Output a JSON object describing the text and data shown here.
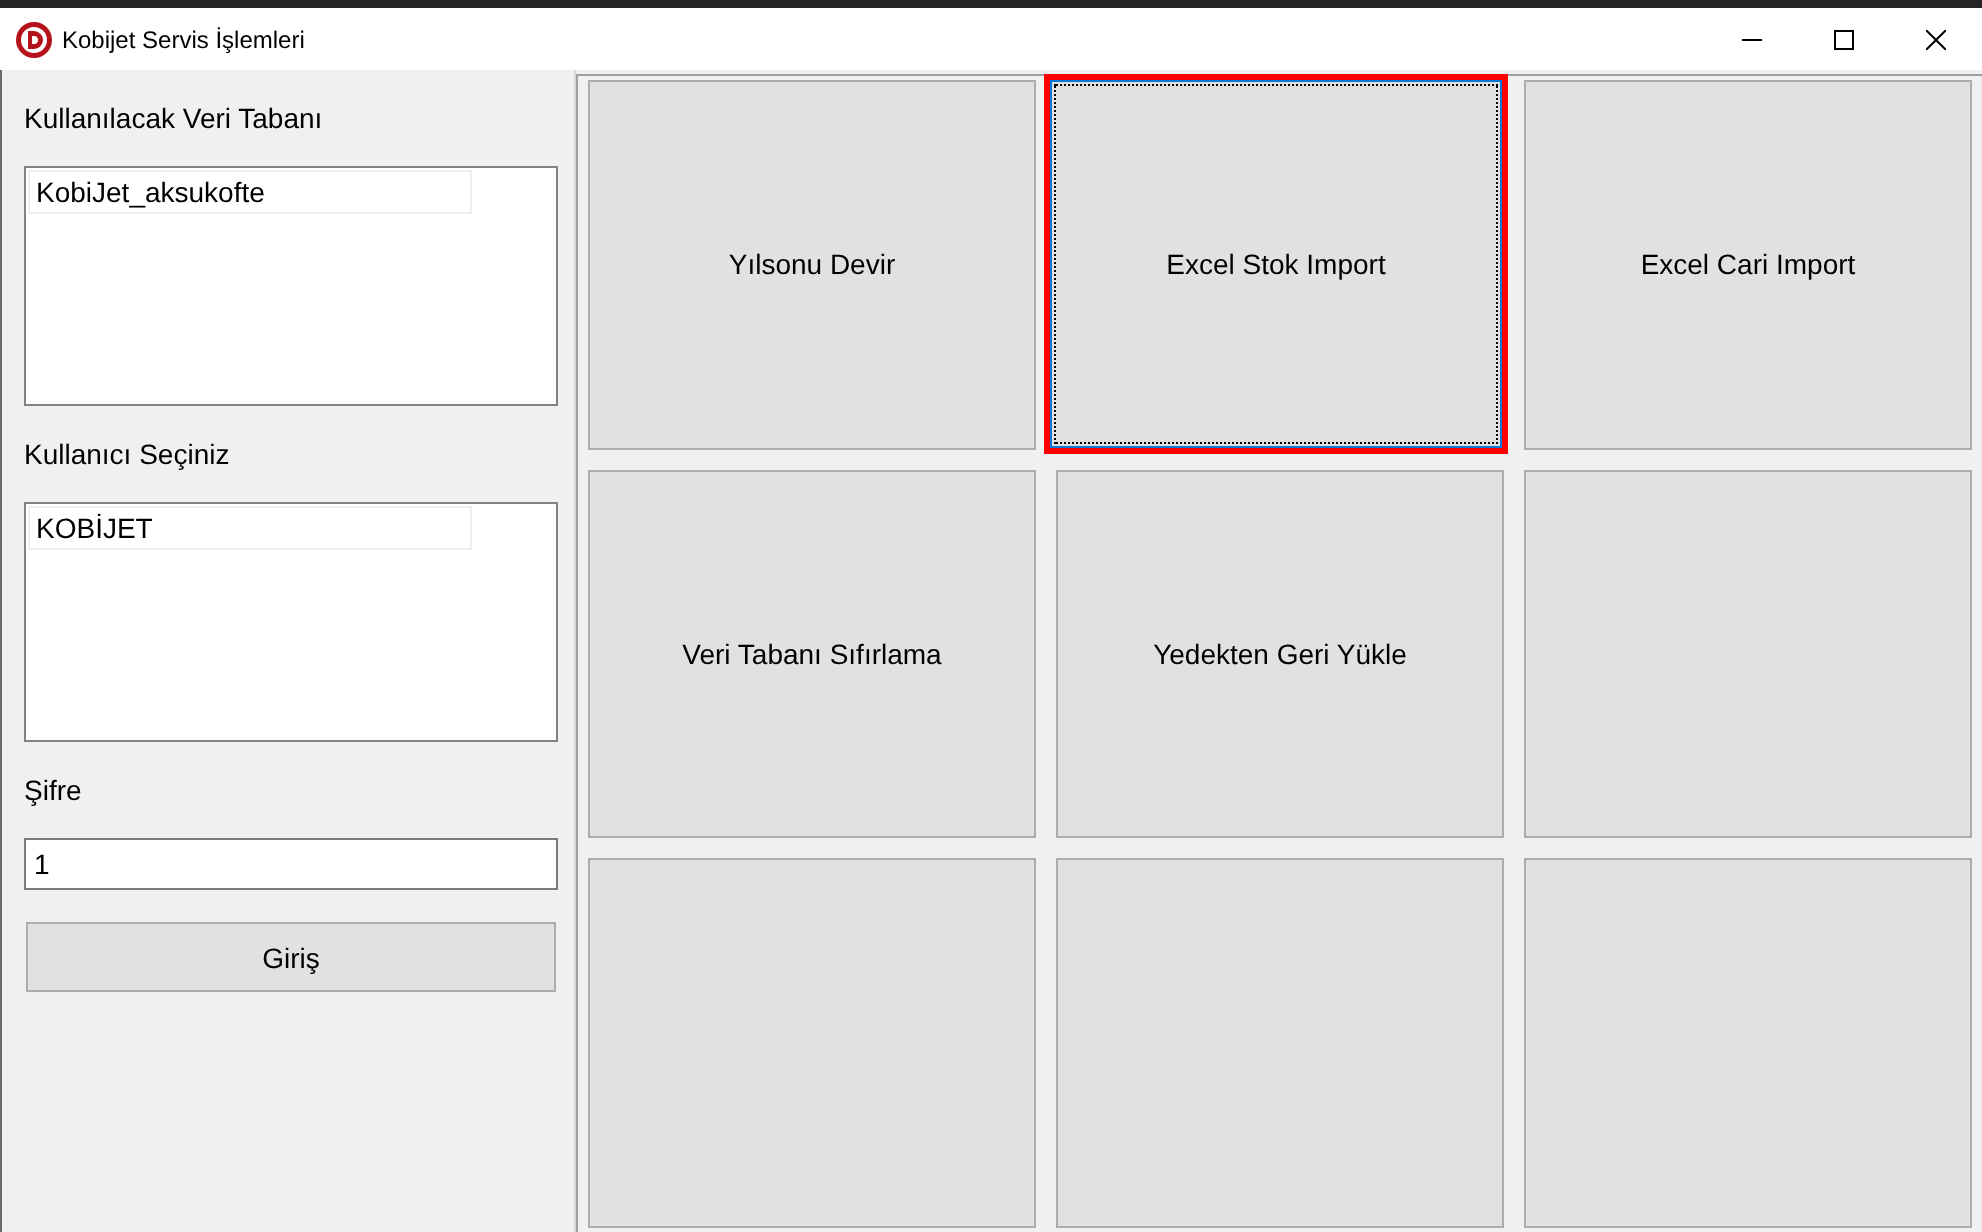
{
  "window": {
    "title": "Kobijet Servis İşlemleri"
  },
  "sidebar": {
    "database": {
      "label": "Kullanılacak Veri Tabanı",
      "items": [
        {
          "label": "KobiJet_aksukofte"
        }
      ]
    },
    "user": {
      "label": "Kullanıcı Seçiniz",
      "items": [
        {
          "label": "KOBİJET"
        }
      ]
    },
    "password": {
      "label": "Şifre",
      "value": "1"
    },
    "login_button": "Giriş"
  },
  "buttons": [
    {
      "label": "Yılsonu Devir",
      "highlighted": false
    },
    {
      "label": "Excel Stok Import",
      "highlighted": true
    },
    {
      "label": "Excel Cari Import",
      "highlighted": false
    },
    {
      "label": "Veri Tabanı Sıfırlama",
      "highlighted": false
    },
    {
      "label": "Yedekten Geri Yükle",
      "highlighted": false
    },
    {
      "highlighted": false
    },
    {
      "highlighted": false
    },
    {
      "highlighted": false
    },
    {
      "highlighted": false
    }
  ]
}
